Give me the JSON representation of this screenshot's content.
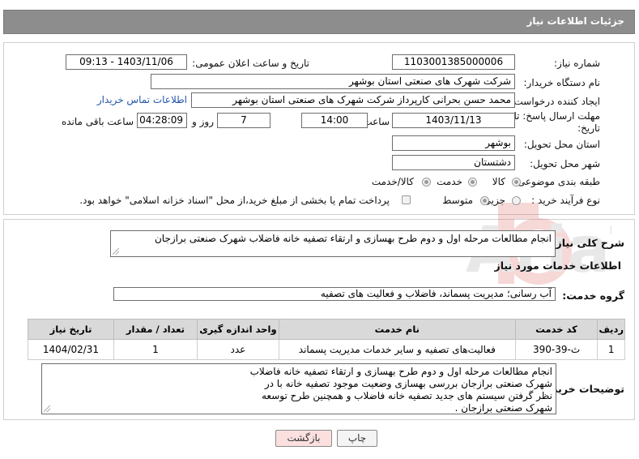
{
  "header": {
    "title": "جزئیات اطلاعات نیاز"
  },
  "form": {
    "need_number_label": "شماره نیاز:",
    "need_number": "1103001385000006",
    "announce_label": "تاریخ و ساعت اعلان عمومی:",
    "announce_value": "1403/11/06 - 09:13",
    "buyer_org_label": "نام دستگاه خریدار:",
    "buyer_org": "شرکت شهرک های صنعتی استان بوشهر",
    "requester_label": "ایجاد کننده درخواست:",
    "requester": "محمد حسن بحرانی کارپرداز شرکت شهرک های صنعتی استان بوشهر",
    "contact_link": "اطلاعات تماس خریدار",
    "deadline_label_1": "مهلت ارسال پاسخ: تا",
    "deadline_label_2": "تاریخ:",
    "deadline_date": "1403/11/13",
    "time_label": "ساعت",
    "deadline_time": "14:00",
    "days_value": "7",
    "days_label": "روز و",
    "remaining_value": "04:28:09",
    "remaining_label": "ساعت باقی مانده",
    "province_label": "استان محل تحویل:",
    "province": "بوشهر",
    "city_label": "شهر محل تحویل:",
    "city": "دشتستان",
    "category_label": "طبقه بندی موضوعی:",
    "category_options": [
      "کالا",
      "خدمت",
      "کالا/خدمت"
    ],
    "process_label": "نوع فرآیند خرید :",
    "process_options": [
      "جزیی",
      "متوسط"
    ],
    "payment_note": "پرداخت تمام یا بخشی از مبلغ خرید،از محل \"اسناد خزانه اسلامی\" خواهد بود."
  },
  "details": {
    "summary_label": "شرح کلی نیاز:",
    "summary": "انجام مطالعات مرحله اول و دوم طرح بهسازی و ارتقاء تصفیه خانه فاضلاب شهرک صنعتی برازجان",
    "services_title": "اطلاعات خدمات مورد نیاز",
    "service_group_label": "گروه خدمت:",
    "service_group": "آب رسانی؛ مدیریت پسماند، فاضلاب و فعالیت های تصفیه",
    "table": {
      "headers": [
        "ردیف",
        "کد خدمت",
        "نام خدمت",
        "واحد اندازه گیری",
        "تعداد / مقدار",
        "تاریخ نیاز"
      ],
      "rows": [
        [
          "1",
          "ث-39-390",
          "فعالیت‌های تصفیه و سایر خدمات مدیریت پسماند",
          "عدد",
          "1",
          "1404/02/31"
        ]
      ]
    },
    "buyer_notes_label": "توضیحات خریدار:",
    "buyer_notes": [
      "انجام مطالعات مرحله اول و دوم طرح بهسازی و ارتقاء تصفیه خانه فاضلاب",
      "شهرک صنعتی برازجان بررسی بهسازی وضعیت موجود تصفیه خانه با در",
      "نظر گرفتن سیستم های جدید تصفیه خانه فاضلاب و همچنین طرح توسعه",
      "شهرک صنعتی برازجان ."
    ]
  },
  "buttons": {
    "print": "چاپ",
    "back": "بازگشت"
  },
  "watermark": {
    "text": "AriaTender.net"
  },
  "colors": {
    "header_bg": "#8d8d8d",
    "link": "#2255aa",
    "back_btn": "#fce0e0",
    "watermark": "#d9534f"
  }
}
